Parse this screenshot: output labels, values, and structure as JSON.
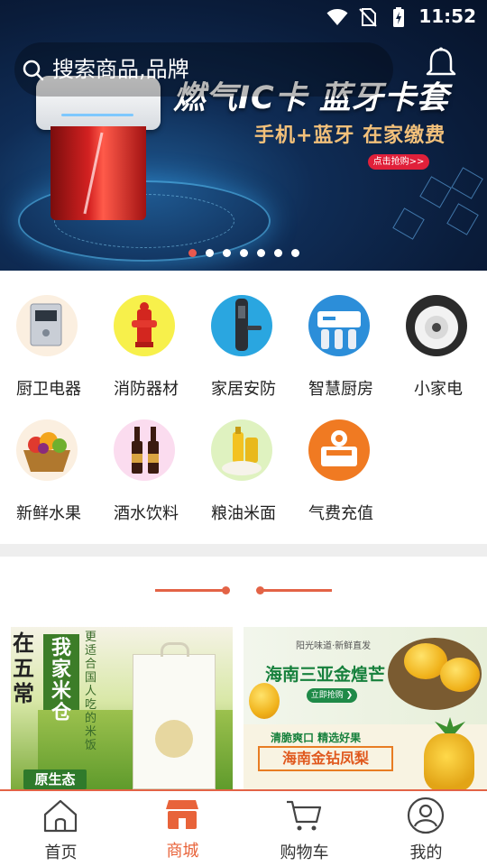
{
  "status_bar": {
    "time": "11:52",
    "icons": [
      "wifi-icon",
      "no-sim-icon",
      "battery-charging-icon"
    ]
  },
  "search": {
    "placeholder": "搜索商品,品牌",
    "icon": "search-icon"
  },
  "header": {
    "notification_icon": "bell-icon"
  },
  "banner": {
    "title": "燃气IC卡 蓝牙卡套",
    "subtitle": "手机+蓝牙 在家缴费",
    "cta": "点击抢购>>",
    "slide_count": 7,
    "active_slide": 1
  },
  "categories": [
    {
      "label": "厨卫电器",
      "icon": "water-heater-icon"
    },
    {
      "label": "消防器材",
      "icon": "fire-hydrant-icon"
    },
    {
      "label": "家居安防",
      "icon": "smart-lock-icon"
    },
    {
      "label": "智慧厨房",
      "icon": "water-purifier-icon"
    },
    {
      "label": "小家电",
      "icon": "robot-vacuum-icon"
    },
    {
      "label": "新鲜水果",
      "icon": "fruit-basket-icon"
    },
    {
      "label": "酒水饮料",
      "icon": "wine-bottles-icon"
    },
    {
      "label": "粮油米面",
      "icon": "oil-rice-icon"
    },
    {
      "label": "气费充值",
      "icon": "gas-recharge-icon"
    }
  ],
  "promos": {
    "rice": {
      "heading": "在五常",
      "brand": "我家米仓",
      "slogan": "更适合国人吃的米饭",
      "badge": "原生态"
    },
    "fruit": {
      "tagline": "阳光味道·新鲜直发",
      "title1": "海南三亚金煌芒",
      "button": "立即抢购 ❯",
      "tagline2": "清脆爽口 精选好果",
      "title2": "海南金钻凤梨"
    }
  },
  "tabbar": [
    {
      "label": "首页",
      "icon": "home-icon",
      "active": false
    },
    {
      "label": "商城",
      "icon": "store-icon",
      "active": true
    },
    {
      "label": "购物车",
      "icon": "cart-icon",
      "active": false
    },
    {
      "label": "我的",
      "icon": "profile-icon",
      "active": false
    }
  ],
  "colors": {
    "accent": "#e8633a",
    "active_dot": "#e8584e"
  }
}
